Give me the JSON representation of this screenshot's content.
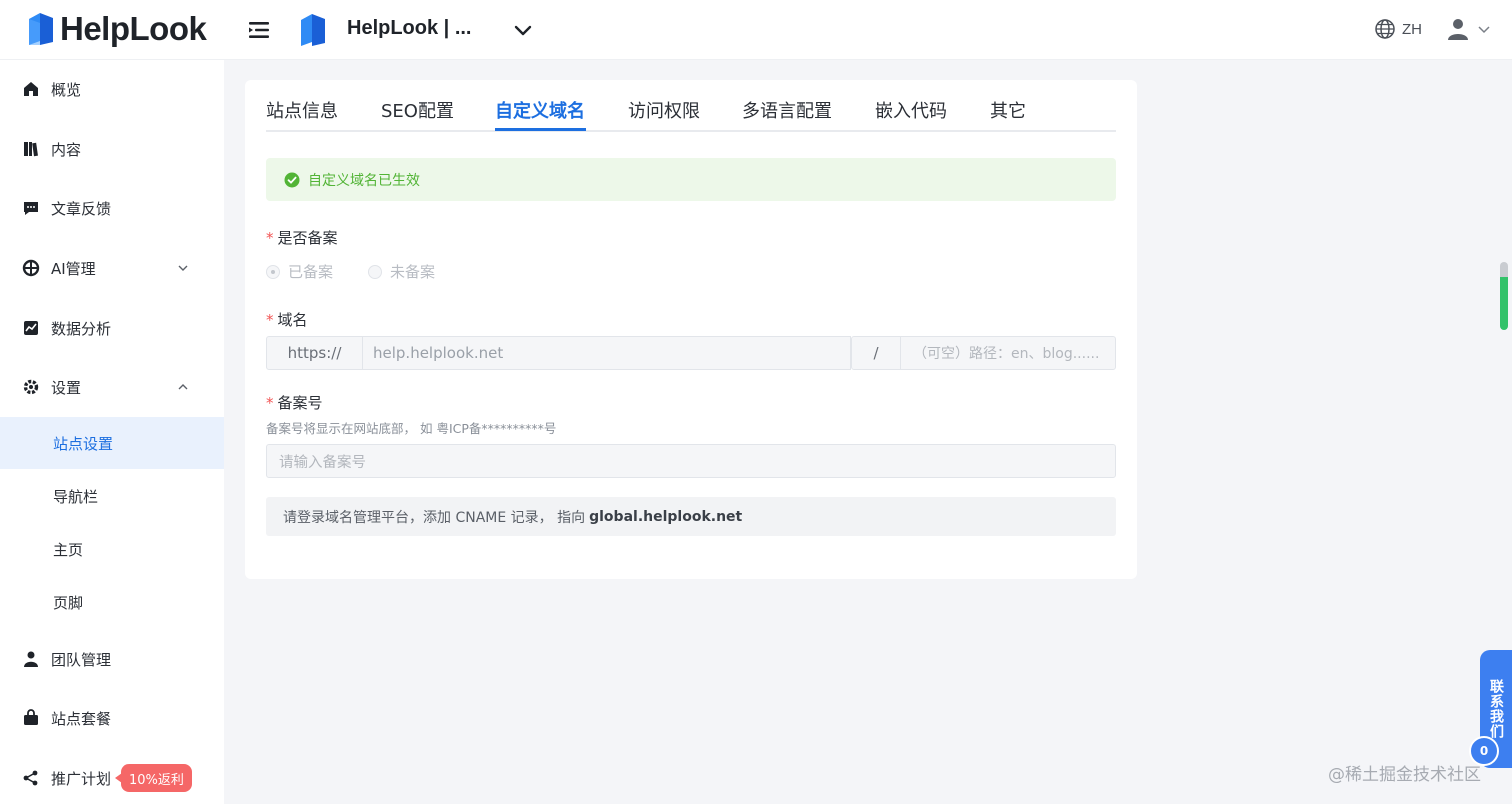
{
  "header": {
    "brand": "HelpLook",
    "site_name": "HelpLook | ...",
    "language": "ZH"
  },
  "sidebar": {
    "items": [
      {
        "label": "概览",
        "icon": "home-icon"
      },
      {
        "label": "内容",
        "icon": "book-icon"
      },
      {
        "label": "文章反馈",
        "icon": "comment-icon"
      },
      {
        "label": "AI管理",
        "icon": "ai-icon"
      },
      {
        "label": "数据分析",
        "icon": "chart-icon"
      },
      {
        "label": "设置",
        "icon": "gear-icon"
      }
    ],
    "sub_items": [
      "站点设置",
      "导航栏",
      "主页",
      "页脚"
    ],
    "bottom_items": [
      {
        "label": "团队管理",
        "icon": "user-icon"
      },
      {
        "label": "站点套餐",
        "icon": "bag-icon"
      },
      {
        "label": "推广计划",
        "icon": "share-icon"
      }
    ],
    "promo_badge": "10%返利"
  },
  "tabs": [
    "站点信息",
    "SEO配置",
    "自定义域名",
    "访问权限",
    "多语言配置",
    "嵌入代码",
    "其它"
  ],
  "active_tab": "自定义域名",
  "alert": {
    "text": "自定义域名已生效"
  },
  "form": {
    "filing": {
      "label": "是否备案",
      "options": [
        "已备案",
        "未备案"
      ],
      "selected": "已备案"
    },
    "domain": {
      "label": "域名",
      "prefix": "https://",
      "value": "help.helplook.net",
      "separator": "/",
      "path_placeholder": "（可空）路径：en、blog......"
    },
    "icp": {
      "label": "备案号",
      "hint": "备案号将显示在网站底部， 如 粤ICP备**********号",
      "placeholder": "请输入备案号"
    },
    "note": {
      "text": "请登录域名管理平台，添加 CNAME 记录， 指向",
      "target": "global.helplook.net"
    }
  },
  "contact": {
    "label": "联系我们",
    "count": "0"
  },
  "watermark": "@稀土掘金技术社区",
  "colors": {
    "primary": "#1d6fe0",
    "success": "#52b436",
    "danger": "#f25555",
    "promo": "#f56767"
  }
}
